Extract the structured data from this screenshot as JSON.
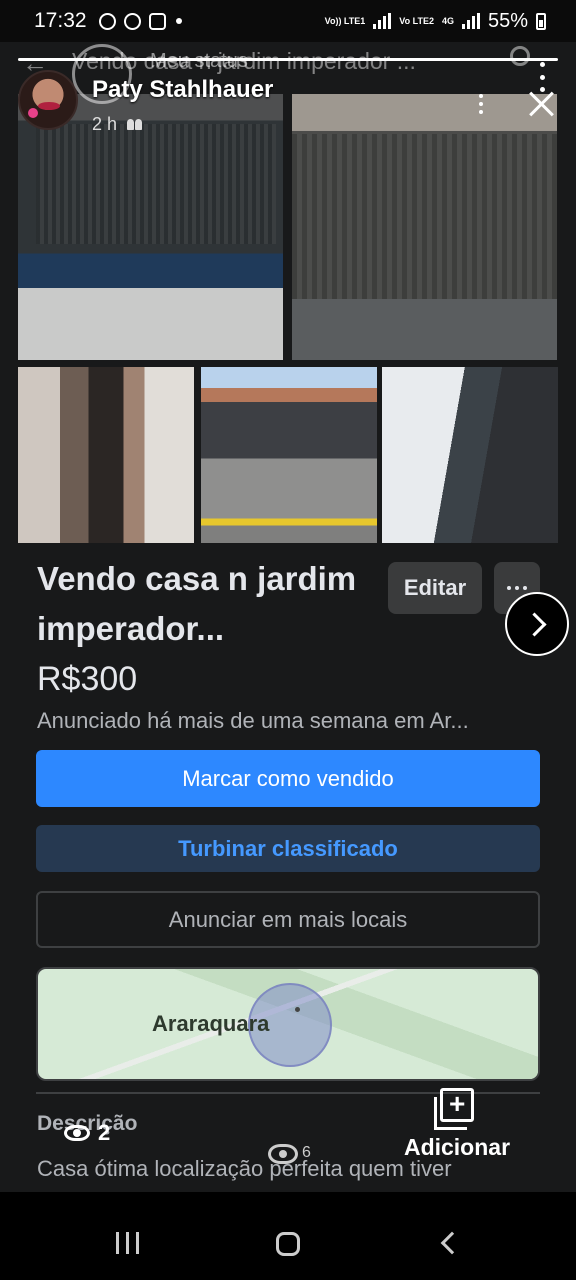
{
  "status_bar": {
    "time": "17:32",
    "network1": "Vo)) LTE1",
    "network2": "Vo LTE2",
    "network_type": "4G",
    "battery": "55%"
  },
  "ghost_header": {
    "title": "Vendo casa n jardim imperador ..."
  },
  "story": {
    "meu_status": "Meu status",
    "user_name": "Paty Stahlhauer",
    "time_ago": "2 h",
    "audience_icon": "people-icon"
  },
  "listing": {
    "title": "Vendo casa n jardim imperador...",
    "edit_label": "Editar",
    "price": "R$300",
    "listed_text": "Anunciado há mais de uma semana em Ar...",
    "mark_sold_label": "Marcar como vendido",
    "boost_label": "Turbinar classificado",
    "more_places_label": "Anunciar em mais locais",
    "map_label": "Araraquara",
    "description_heading": "Descrição",
    "description_text": "Casa ótima localização perfeita quem tiver"
  },
  "overlay": {
    "viewer_count": "2",
    "viewer_count_small": "6",
    "add_label": "Adicionar"
  },
  "colors": {
    "primary": "#2d88ff",
    "boost_bg": "#263951",
    "card_bg": "#18191a"
  }
}
